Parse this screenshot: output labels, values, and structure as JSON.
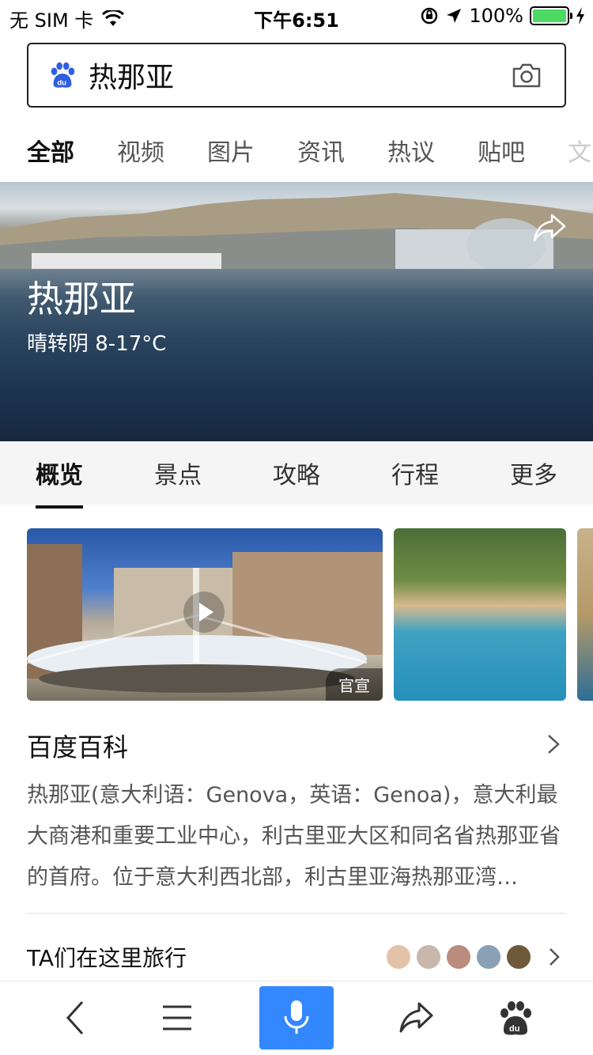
{
  "status_bar": {
    "carrier": "无 SIM 卡",
    "time": "下午6:51",
    "battery": "100%",
    "icons": [
      "wifi-icon",
      "orientation-lock-icon",
      "location-arrow-icon",
      "battery-icon",
      "charging-icon"
    ],
    "battery_color": "#4cd964"
  },
  "search": {
    "query": "热那亚",
    "logo_icon": "baidu-paw-icon",
    "camera_icon": "camera-icon"
  },
  "tabs": [
    {
      "label": "全部",
      "active": true
    },
    {
      "label": "视频"
    },
    {
      "label": "图片"
    },
    {
      "label": "资讯"
    },
    {
      "label": "热议"
    },
    {
      "label": "贴吧"
    },
    {
      "label": "文"
    }
  ],
  "hero": {
    "title": "热那亚",
    "weather": "晴转阴 8-17°C",
    "share_icon": "share-icon"
  },
  "subtabs": [
    {
      "label": "概览",
      "active": true
    },
    {
      "label": "景点"
    },
    {
      "label": "攻略"
    },
    {
      "label": "行程"
    },
    {
      "label": "更多"
    }
  ],
  "media": {
    "badge": "官宣",
    "play_icon": "play-icon"
  },
  "baike": {
    "title": "百度百科",
    "description": "热那亚(意大利语：Genova，英语：Genoa)，意大利最大商港和重要工业中心，利古里亚大区和同名省热那亚省的首府。位于意大利西北部，利古里亚海热那亚湾…"
  },
  "travel": {
    "title": "TA们在这里旅行"
  },
  "bottom_bar": {
    "icons": [
      "back-icon",
      "menu-icon",
      "microphone-icon",
      "share-icon",
      "baidu-paw-icon"
    ]
  },
  "colors": {
    "accent": "#3388ff",
    "tab_underline": "#3388ff"
  }
}
